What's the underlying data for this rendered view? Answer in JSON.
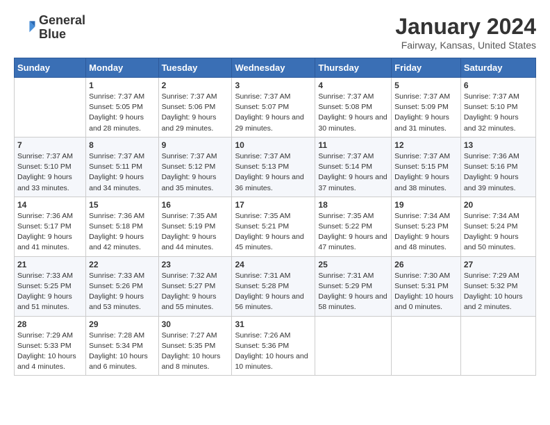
{
  "header": {
    "logo_line1": "General",
    "logo_line2": "Blue",
    "title": "January 2024",
    "subtitle": "Fairway, Kansas, United States"
  },
  "columns": [
    "Sunday",
    "Monday",
    "Tuesday",
    "Wednesday",
    "Thursday",
    "Friday",
    "Saturday"
  ],
  "weeks": [
    [
      {
        "day": "",
        "sunrise": "",
        "sunset": "",
        "daylight": ""
      },
      {
        "day": "1",
        "sunrise": "Sunrise: 7:37 AM",
        "sunset": "Sunset: 5:05 PM",
        "daylight": "Daylight: 9 hours and 28 minutes."
      },
      {
        "day": "2",
        "sunrise": "Sunrise: 7:37 AM",
        "sunset": "Sunset: 5:06 PM",
        "daylight": "Daylight: 9 hours and 29 minutes."
      },
      {
        "day": "3",
        "sunrise": "Sunrise: 7:37 AM",
        "sunset": "Sunset: 5:07 PM",
        "daylight": "Daylight: 9 hours and 29 minutes."
      },
      {
        "day": "4",
        "sunrise": "Sunrise: 7:37 AM",
        "sunset": "Sunset: 5:08 PM",
        "daylight": "Daylight: 9 hours and 30 minutes."
      },
      {
        "day": "5",
        "sunrise": "Sunrise: 7:37 AM",
        "sunset": "Sunset: 5:09 PM",
        "daylight": "Daylight: 9 hours and 31 minutes."
      },
      {
        "day": "6",
        "sunrise": "Sunrise: 7:37 AM",
        "sunset": "Sunset: 5:10 PM",
        "daylight": "Daylight: 9 hours and 32 minutes."
      }
    ],
    [
      {
        "day": "7",
        "sunrise": "Sunrise: 7:37 AM",
        "sunset": "Sunset: 5:10 PM",
        "daylight": "Daylight: 9 hours and 33 minutes."
      },
      {
        "day": "8",
        "sunrise": "Sunrise: 7:37 AM",
        "sunset": "Sunset: 5:11 PM",
        "daylight": "Daylight: 9 hours and 34 minutes."
      },
      {
        "day": "9",
        "sunrise": "Sunrise: 7:37 AM",
        "sunset": "Sunset: 5:12 PM",
        "daylight": "Daylight: 9 hours and 35 minutes."
      },
      {
        "day": "10",
        "sunrise": "Sunrise: 7:37 AM",
        "sunset": "Sunset: 5:13 PM",
        "daylight": "Daylight: 9 hours and 36 minutes."
      },
      {
        "day": "11",
        "sunrise": "Sunrise: 7:37 AM",
        "sunset": "Sunset: 5:14 PM",
        "daylight": "Daylight: 9 hours and 37 minutes."
      },
      {
        "day": "12",
        "sunrise": "Sunrise: 7:37 AM",
        "sunset": "Sunset: 5:15 PM",
        "daylight": "Daylight: 9 hours and 38 minutes."
      },
      {
        "day": "13",
        "sunrise": "Sunrise: 7:36 AM",
        "sunset": "Sunset: 5:16 PM",
        "daylight": "Daylight: 9 hours and 39 minutes."
      }
    ],
    [
      {
        "day": "14",
        "sunrise": "Sunrise: 7:36 AM",
        "sunset": "Sunset: 5:17 PM",
        "daylight": "Daylight: 9 hours and 41 minutes."
      },
      {
        "day": "15",
        "sunrise": "Sunrise: 7:36 AM",
        "sunset": "Sunset: 5:18 PM",
        "daylight": "Daylight: 9 hours and 42 minutes."
      },
      {
        "day": "16",
        "sunrise": "Sunrise: 7:35 AM",
        "sunset": "Sunset: 5:19 PM",
        "daylight": "Daylight: 9 hours and 44 minutes."
      },
      {
        "day": "17",
        "sunrise": "Sunrise: 7:35 AM",
        "sunset": "Sunset: 5:21 PM",
        "daylight": "Daylight: 9 hours and 45 minutes."
      },
      {
        "day": "18",
        "sunrise": "Sunrise: 7:35 AM",
        "sunset": "Sunset: 5:22 PM",
        "daylight": "Daylight: 9 hours and 47 minutes."
      },
      {
        "day": "19",
        "sunrise": "Sunrise: 7:34 AM",
        "sunset": "Sunset: 5:23 PM",
        "daylight": "Daylight: 9 hours and 48 minutes."
      },
      {
        "day": "20",
        "sunrise": "Sunrise: 7:34 AM",
        "sunset": "Sunset: 5:24 PM",
        "daylight": "Daylight: 9 hours and 50 minutes."
      }
    ],
    [
      {
        "day": "21",
        "sunrise": "Sunrise: 7:33 AM",
        "sunset": "Sunset: 5:25 PM",
        "daylight": "Daylight: 9 hours and 51 minutes."
      },
      {
        "day": "22",
        "sunrise": "Sunrise: 7:33 AM",
        "sunset": "Sunset: 5:26 PM",
        "daylight": "Daylight: 9 hours and 53 minutes."
      },
      {
        "day": "23",
        "sunrise": "Sunrise: 7:32 AM",
        "sunset": "Sunset: 5:27 PM",
        "daylight": "Daylight: 9 hours and 55 minutes."
      },
      {
        "day": "24",
        "sunrise": "Sunrise: 7:31 AM",
        "sunset": "Sunset: 5:28 PM",
        "daylight": "Daylight: 9 hours and 56 minutes."
      },
      {
        "day": "25",
        "sunrise": "Sunrise: 7:31 AM",
        "sunset": "Sunset: 5:29 PM",
        "daylight": "Daylight: 9 hours and 58 minutes."
      },
      {
        "day": "26",
        "sunrise": "Sunrise: 7:30 AM",
        "sunset": "Sunset: 5:31 PM",
        "daylight": "Daylight: 10 hours and 0 minutes."
      },
      {
        "day": "27",
        "sunrise": "Sunrise: 7:29 AM",
        "sunset": "Sunset: 5:32 PM",
        "daylight": "Daylight: 10 hours and 2 minutes."
      }
    ],
    [
      {
        "day": "28",
        "sunrise": "Sunrise: 7:29 AM",
        "sunset": "Sunset: 5:33 PM",
        "daylight": "Daylight: 10 hours and 4 minutes."
      },
      {
        "day": "29",
        "sunrise": "Sunrise: 7:28 AM",
        "sunset": "Sunset: 5:34 PM",
        "daylight": "Daylight: 10 hours and 6 minutes."
      },
      {
        "day": "30",
        "sunrise": "Sunrise: 7:27 AM",
        "sunset": "Sunset: 5:35 PM",
        "daylight": "Daylight: 10 hours and 8 minutes."
      },
      {
        "day": "31",
        "sunrise": "Sunrise: 7:26 AM",
        "sunset": "Sunset: 5:36 PM",
        "daylight": "Daylight: 10 hours and 10 minutes."
      },
      {
        "day": "",
        "sunrise": "",
        "sunset": "",
        "daylight": ""
      },
      {
        "day": "",
        "sunrise": "",
        "sunset": "",
        "daylight": ""
      },
      {
        "day": "",
        "sunrise": "",
        "sunset": "",
        "daylight": ""
      }
    ]
  ]
}
